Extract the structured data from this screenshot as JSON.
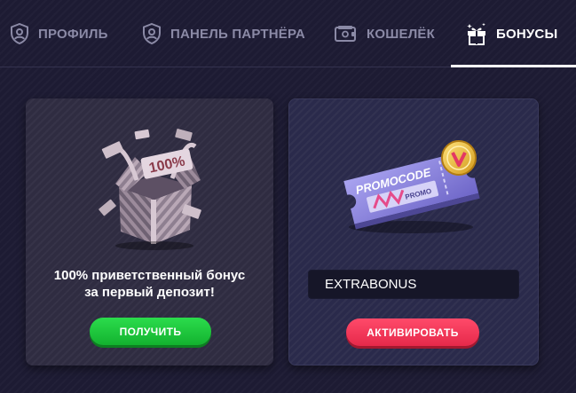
{
  "tabs": [
    {
      "label": "ПРОФИЛЬ",
      "icon": "user-shield-icon",
      "active": false
    },
    {
      "label": "ПАНЕЛЬ ПАРТНЁРА",
      "icon": "user-shield-icon",
      "active": false
    },
    {
      "label": "КОШЕЛЁК",
      "icon": "wallet-icon",
      "active": false
    },
    {
      "label": "БОНУСЫ",
      "icon": "gift-icon",
      "active": true
    }
  ],
  "bonus_card": {
    "art": "gift-box-100-percent",
    "art_text": "100%",
    "text_line1": "100% приветственный бонус",
    "text_line2": "за первый депозит!",
    "button_label": "ПОЛУЧИТЬ"
  },
  "promo_card": {
    "art": "promocode-ticket",
    "ticket_text": "PROMOCODE",
    "ticket_small_text": "PROMO",
    "input_value": "EXTRABONUS",
    "button_label": "АКТИВИРОВАТЬ"
  },
  "colors": {
    "background": "#1d1b33",
    "tab_inactive": "#8b8aa6",
    "tab_active": "#ffffff",
    "get_button": "#1fc83c",
    "activate_button": "#f0365a",
    "coin": "#f0c040"
  }
}
